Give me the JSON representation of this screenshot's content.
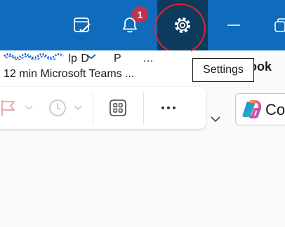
{
  "titlebar": {
    "notification_count": "1",
    "icons": [
      "my-day-icon",
      "notifications-bell-icon",
      "settings-gear-icon",
      "minimize-icon",
      "restore-icon"
    ],
    "accent_color": "#0f6cbd",
    "active_button_color": "#0c3b5e"
  },
  "annotation": {
    "shape": "hand-drawn-circle",
    "color": "#e0232e",
    "target": "settings-button"
  },
  "preview": {
    "sender_fragment_1": "lp D",
    "sender_fragment_2": "P",
    "sender_fragment_3": "...",
    "message_line": "12 min Microsoft Teams ...",
    "right_fragment": "ook"
  },
  "tooltip": {
    "label": "Settings"
  },
  "ribbon": {
    "icons": [
      "flag-icon",
      "chevron-down-icon",
      "clock-icon",
      "chevron-down-icon",
      "apps-grid-icon",
      "more-options-icon",
      "chevron-down-icon"
    ],
    "copilot_label": "Cop"
  }
}
